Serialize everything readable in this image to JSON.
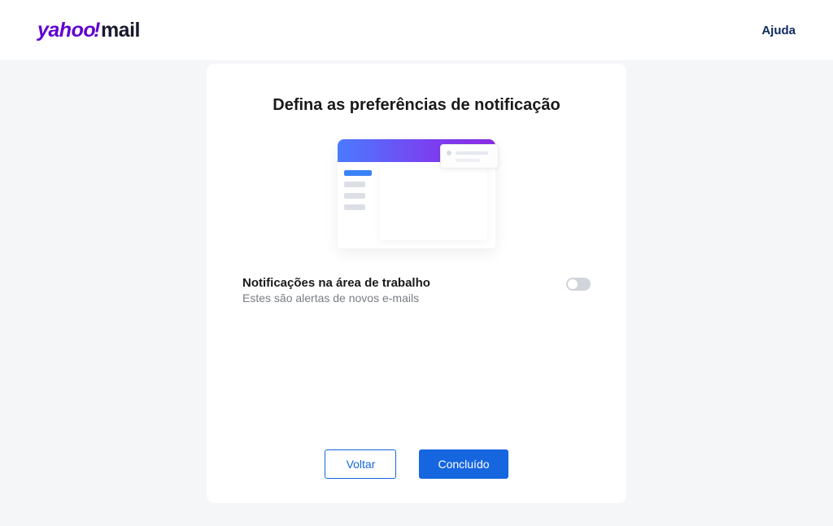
{
  "header": {
    "logo_yahoo": "yahoo",
    "logo_excl": "!",
    "logo_mail": "mail",
    "help_label": "Ajuda"
  },
  "card": {
    "title": "Defina as preferências de notificação",
    "setting": {
      "title": "Notificações na área de trabalho",
      "description": "Estes são alertas de novos e-mails",
      "toggle_on": false
    },
    "buttons": {
      "back": "Voltar",
      "done": "Concluído"
    }
  }
}
